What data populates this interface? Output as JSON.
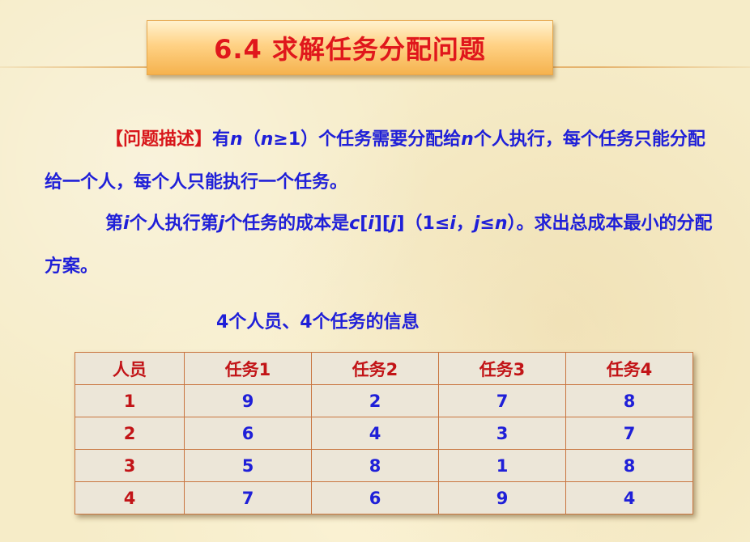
{
  "title": "6.4 求解任务分配问题",
  "paragraph1": {
    "bracket_label": "【问题描述】",
    "t1": "有",
    "n1": "n",
    "t2": "（",
    "n2": "n",
    "t3": "≥1）个任务需要分配给",
    "n3": "n",
    "t4": "个人执行，每个任务只能分配给一个人，每个人只能执行一个任务。"
  },
  "paragraph2": {
    "t1": "第",
    "i1": "i",
    "t2": "个人执行第",
    "j1": "j",
    "t3": "个任务的成本是",
    "c": "c",
    "b1": "[",
    "i2": "i",
    "b2": "][",
    "j2": "j",
    "b3": "]",
    "t4": "（1≤",
    "i3": "i",
    "t5": "，",
    "j3": "j",
    "t6": "≤",
    "n": "n",
    "t7": "）。求出总成本最小的分配方案。"
  },
  "table_caption": "4个人员、4个任务的信息",
  "table": {
    "headers": [
      "人员",
      "任务1",
      "任务2",
      "任务3",
      "任务4"
    ],
    "rows": [
      [
        "1",
        "9",
        "2",
        "7",
        "8"
      ],
      [
        "2",
        "6",
        "4",
        "3",
        "7"
      ],
      [
        "3",
        "5",
        "8",
        "1",
        "8"
      ],
      [
        "4",
        "7",
        "6",
        "9",
        "4"
      ]
    ]
  },
  "colors": {
    "title_red": "#e0171c",
    "text_blue": "#1f1fd8",
    "table_red": "#c21417",
    "table_border": "#c9753f"
  }
}
